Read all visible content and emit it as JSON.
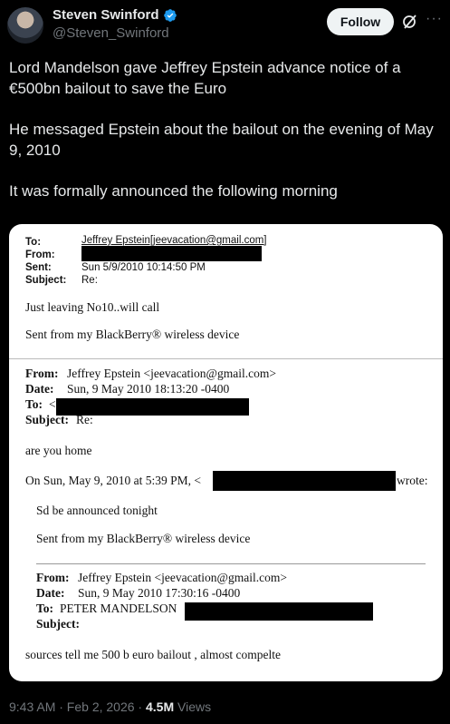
{
  "author": {
    "name": "Steven Swinford",
    "handle": "@Steven_Swinford"
  },
  "actions": {
    "follow_label": "Follow",
    "grok_icon": "grok-icon",
    "more_label": "···"
  },
  "tweet": {
    "p1": "Lord Mandelson gave Jeffrey Epstein advance notice of a €500bn bailout to save the Euro",
    "p2": "He messaged Epstein about the bailout on the evening of May 9, 2010",
    "p3": "It was formally announced the following morning"
  },
  "email1": {
    "to_label": "To:",
    "to_value": "Jeffrey Epstein[jeevacation@gmail.com]",
    "from_label": "From:",
    "sent_label": "Sent:",
    "sent_value": "Sun 5/9/2010 10:14:50 PM",
    "subject_label": "Subject:",
    "subject_value": "Re:",
    "body": "Just leaving No10..will call",
    "footer": "Sent from my BlackBerry® wireless device"
  },
  "email2": {
    "from_label": "From:",
    "from_value": "Jeffrey Epstein <jeevacation@gmail.com>",
    "date_label": "Date:",
    "date_value": "Sun, 9 May 2010 18:13:20 -0400",
    "to_label": "To:",
    "to_value": "<",
    "subject_label": "Subject:",
    "subject_value": "Re:",
    "body": "are you home",
    "on_line": "On Sun, May 9, 2010 at 5:39 PM, <",
    "wrote": "wrote:",
    "quote1": "Sd be announced tonight",
    "quote2": "Sent from my BlackBerry® wireless device"
  },
  "email3": {
    "from_label": "From:",
    "from_value": "Jeffrey Epstein <jeevacation@gmail.com>",
    "date_label": "Date:",
    "date_value": "Sun, 9 May 2010 17:30:16 -0400",
    "to_label": "To:",
    "to_value": "PETER MANDELSON",
    "subject_label": "Subject:",
    "body": "sources tell me 500 b euro bailout , almost compelte"
  },
  "meta": {
    "time": "9:43 AM · Feb 2, 2026 · ",
    "views_count": "4.5M",
    "views_label": " Views"
  }
}
